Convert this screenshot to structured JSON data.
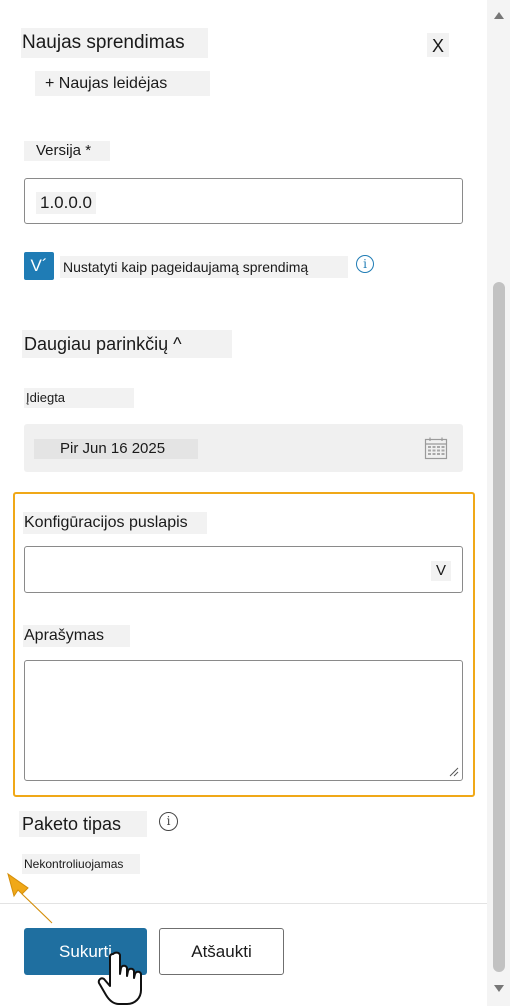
{
  "panel": {
    "title": "Naujas sprendimas",
    "close_label": "X",
    "new_publisher_label": "+ Naujas leidėjas"
  },
  "version": {
    "label": "Versija *",
    "value": "1.0.0.0"
  },
  "preferred": {
    "checkbox_mark": "V´",
    "label": "Nustatyti kaip pageidaujamą sprendimą",
    "info_glyph": "i"
  },
  "more_options": {
    "label": "Daugiau parinkčių ^"
  },
  "installed": {
    "label": "Įdiegta",
    "value": "Pir Jun 16 2025",
    "icon": "calendar-icon"
  },
  "config_page": {
    "label": "Konfigūracijos puslapis",
    "value": "",
    "chevron": "V"
  },
  "description": {
    "label": "Aprašymas",
    "value": ""
  },
  "package_type": {
    "label": "Paketo tipas",
    "info_glyph": "i",
    "value": "Nekontroliuojamas"
  },
  "footer": {
    "create_label": "Sukurti",
    "cancel_label": "Atšaukti"
  },
  "colors": {
    "accent": "#1f7cb5",
    "primary_button": "#1f6fa0",
    "highlight_border": "#f0a818"
  }
}
